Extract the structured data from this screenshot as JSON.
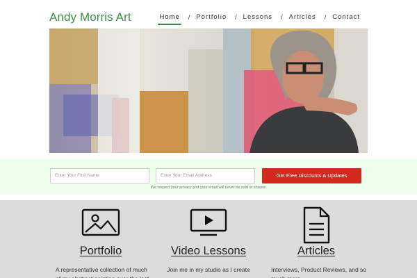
{
  "site": {
    "title": "Andy Morris Art"
  },
  "nav": {
    "items": [
      {
        "label": "Home",
        "active": true
      },
      {
        "label": "Portfolio",
        "active": false
      },
      {
        "label": "Lessons",
        "active": false
      },
      {
        "label": "Articles",
        "active": false
      },
      {
        "label": "Contact",
        "active": false
      }
    ],
    "separator": "/"
  },
  "signup": {
    "first_name_placeholder": "Enter Your First Name",
    "email_placeholder": "Enter Your Email Address",
    "button_label": "Get Free Discounts & Updates",
    "privacy_note": "We respect your privacy and your email will never be sold or shared."
  },
  "features": [
    {
      "title": "Portfolio",
      "icon": "image-icon",
      "description": "A representative collection of much of my abstract painting over the last"
    },
    {
      "title": "Video Lessons",
      "icon": "video-play-icon",
      "description": "Join me in my studio as I create"
    },
    {
      "title": "Articles",
      "icon": "document-icon",
      "description": "Interviews, Product Reviews, and so much more"
    }
  ],
  "colors": {
    "brand": "#3f8f4a",
    "cta": "#d32a1f",
    "signup_bg": "#eefcec",
    "features_bg": "#dcdcdc"
  }
}
